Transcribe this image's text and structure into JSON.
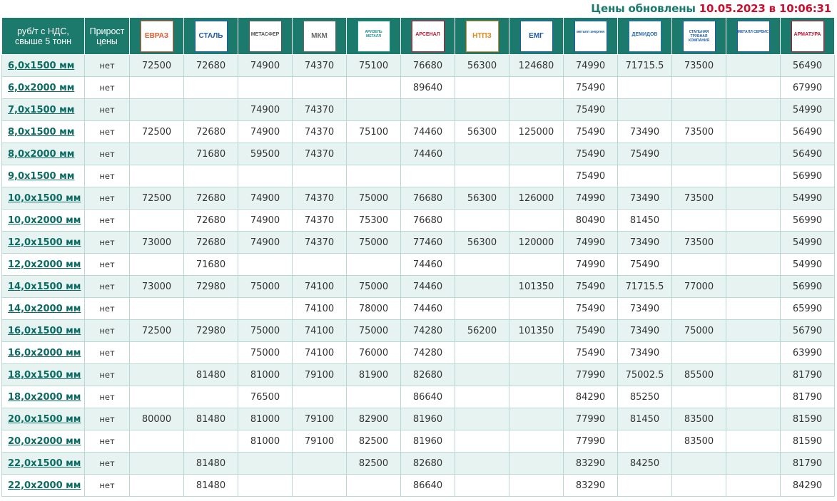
{
  "updated": {
    "prefix": "Цены обновлены",
    "timestamp": "10.05.2023 в 10:06:31"
  },
  "header": {
    "unit": "руб/т с НДС, свыше 5 тонн",
    "growth": "Прирост цены",
    "suppliers": [
      {
        "logo_text": "ЕВРАЗ",
        "icon": "evraz-logo",
        "color": "#e4572e"
      },
      {
        "logo_text": "СТАЛЬ",
        "icon": "stal-logo",
        "color": "#1e5aa8"
      },
      {
        "logo_text": "МЕТАСФЕР",
        "icon": "metasfer-logo",
        "color": "#555555"
      },
      {
        "logo_text": "МКМ",
        "icon": "mkm-logo",
        "color": "#666666"
      },
      {
        "logo_text": "АРИЗЕЛЬ МЕТАЛЛ",
        "icon": "arizel-logo",
        "color": "#1b8f8a"
      },
      {
        "logo_text": "АРСЕНАЛ",
        "icon": "arsenal-logo",
        "color": "#c8102e"
      },
      {
        "logo_text": "НТПЗ",
        "icon": "ntpz-logo",
        "color": "#e08a1e"
      },
      {
        "logo_text": "ЕМГ",
        "icon": "emg-logo",
        "color": "#1e5aa8"
      },
      {
        "logo_text": "металл энергия",
        "icon": "metall-energia-logo",
        "color": "#1e5aa8"
      },
      {
        "logo_text": "ДЕМИДОВ",
        "icon": "demidov-logo",
        "color": "#2a6fb0"
      },
      {
        "logo_text": "СТАЛЬНАЯ ТРУБНАЯ КОМПАНИЯ",
        "icon": "trubnaya-logo",
        "color": "#1e5aa8"
      },
      {
        "logo_text": "МЕТАЛЛ СЕРВИС",
        "icon": "metall-servis-logo",
        "color": "#1e5aa8"
      },
      {
        "logo_text": "АРМАТУРА",
        "icon": "armatura-logo",
        "color": "#c8102e"
      }
    ]
  },
  "rows": [
    {
      "size": "6,0х1500 мм",
      "growth": "нет",
      "prices": [
        "72500",
        "72680",
        "74900",
        "74370",
        "75100",
        "76680",
        "56300",
        "124680",
        "74990",
        "71715.5",
        "73500",
        "",
        "56490"
      ]
    },
    {
      "size": "6,0х2000 мм",
      "growth": "нет",
      "prices": [
        "",
        "",
        "",
        "",
        "",
        "89640",
        "",
        "",
        "75490",
        "",
        "",
        "",
        "67990"
      ]
    },
    {
      "size": "7,0х1500 мм",
      "growth": "нет",
      "prices": [
        "",
        "",
        "74900",
        "74370",
        "",
        "",
        "",
        "",
        "75490",
        "",
        "",
        "",
        "54990"
      ]
    },
    {
      "size": "8,0х1500 мм",
      "growth": "нет",
      "prices": [
        "72500",
        "72680",
        "74900",
        "74370",
        "75100",
        "74460",
        "56300",
        "125000",
        "75490",
        "73490",
        "73500",
        "",
        "56490"
      ]
    },
    {
      "size": "8,0х2000 мм",
      "growth": "нет",
      "prices": [
        "",
        "71680",
        "59500",
        "74370",
        "",
        "74460",
        "",
        "",
        "75490",
        "75490",
        "",
        "",
        "56490"
      ]
    },
    {
      "size": "9,0х1500 мм",
      "growth": "нет",
      "prices": [
        "",
        "",
        "",
        "",
        "",
        "",
        "",
        "",
        "75490",
        "",
        "",
        "",
        "56990"
      ]
    },
    {
      "size": "10,0х1500 мм",
      "growth": "нет",
      "prices": [
        "72500",
        "72680",
        "74900",
        "74370",
        "75000",
        "76680",
        "56300",
        "126000",
        "74990",
        "73490",
        "73500",
        "",
        "54990"
      ]
    },
    {
      "size": "10,0х2000 мм",
      "growth": "нет",
      "prices": [
        "",
        "72680",
        "74900",
        "74370",
        "75300",
        "76680",
        "",
        "",
        "80490",
        "81450",
        "",
        "",
        "56990"
      ]
    },
    {
      "size": "12,0х1500 мм",
      "growth": "нет",
      "prices": [
        "73000",
        "72680",
        "74900",
        "74370",
        "75000",
        "77460",
        "56300",
        "120000",
        "74990",
        "73490",
        "73500",
        "",
        "54990"
      ]
    },
    {
      "size": "12,0х2000 мм",
      "growth": "нет",
      "prices": [
        "",
        "71680",
        "",
        "",
        "",
        "74460",
        "",
        "",
        "74990",
        "75490",
        "",
        "",
        "54990"
      ]
    },
    {
      "size": "14,0х1500 мм",
      "growth": "нет",
      "prices": [
        "73000",
        "72980",
        "75000",
        "74100",
        "75000",
        "74460",
        "",
        "101350",
        "75490",
        "71715.5",
        "77000",
        "",
        "56990"
      ]
    },
    {
      "size": "14,0х2000 мм",
      "growth": "нет",
      "prices": [
        "",
        "",
        "",
        "74100",
        "78000",
        "74460",
        "",
        "",
        "75490",
        "73490",
        "",
        "",
        "65990"
      ]
    },
    {
      "size": "16,0х1500 мм",
      "growth": "нет",
      "prices": [
        "72500",
        "72980",
        "75000",
        "74100",
        "75000",
        "74280",
        "56200",
        "101350",
        "75490",
        "73490",
        "75000",
        "",
        "56790"
      ]
    },
    {
      "size": "16,0х2000 мм",
      "growth": "нет",
      "prices": [
        "",
        "",
        "75000",
        "74100",
        "76000",
        "74280",
        "",
        "",
        "75490",
        "73490",
        "",
        "",
        "63990"
      ]
    },
    {
      "size": "18,0х1500 мм",
      "growth": "нет",
      "prices": [
        "",
        "81480",
        "81000",
        "79100",
        "81900",
        "82680",
        "",
        "",
        "77990",
        "75002.5",
        "85500",
        "",
        "81790"
      ]
    },
    {
      "size": "18,0х2000 мм",
      "growth": "нет",
      "prices": [
        "",
        "",
        "76500",
        "",
        "",
        "86640",
        "",
        "",
        "84290",
        "85250",
        "",
        "",
        "81790"
      ]
    },
    {
      "size": "20,0х1500 мм",
      "growth": "нет",
      "prices": [
        "80000",
        "81480",
        "81000",
        "79100",
        "82900",
        "81960",
        "",
        "",
        "77990",
        "81450",
        "83500",
        "",
        "81590"
      ]
    },
    {
      "size": "20,0х2000 мм",
      "growth": "нет",
      "prices": [
        "",
        "",
        "81000",
        "79100",
        "82500",
        "81960",
        "",
        "",
        "77990",
        "",
        "83500",
        "",
        "81590"
      ]
    },
    {
      "size": "22,0х1500 мм",
      "growth": "нет",
      "prices": [
        "",
        "81480",
        "",
        "",
        "82500",
        "82680",
        "",
        "",
        "83290",
        "84250",
        "",
        "",
        "81790"
      ]
    },
    {
      "size": "22,0х2000 мм",
      "growth": "нет",
      "prices": [
        "",
        "81480",
        "",
        "",
        "",
        "86640",
        "",
        "",
        "83290",
        "",
        "",
        "",
        "84290"
      ]
    }
  ]
}
